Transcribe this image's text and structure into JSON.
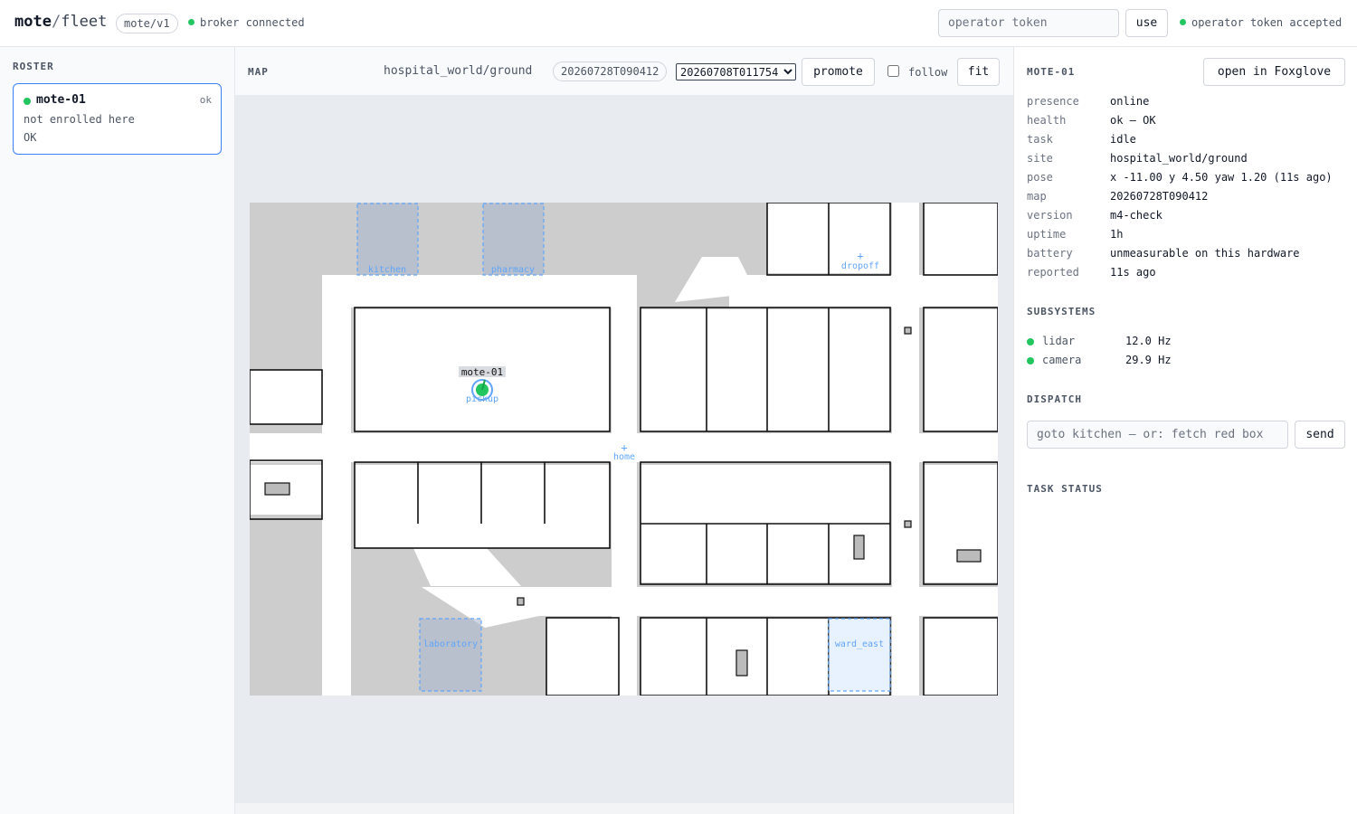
{
  "header": {
    "brand_name": "mote",
    "brand_sep": "/",
    "brand_suffix": "fleet",
    "protocol": "mote/v1",
    "broker_status": "broker connected",
    "token_placeholder": "operator token",
    "use_label": "use",
    "token_status": "operator token accepted"
  },
  "roster": {
    "title": "ROSTER",
    "robots": [
      {
        "name": "mote-01",
        "badge": "ok",
        "note": "not enrolled here",
        "health": "OK"
      }
    ]
  },
  "map": {
    "title": "MAP",
    "site": "hospital_world/ground",
    "current_version": "20260728T090412",
    "selected_version": "20260708T011754",
    "promote_label": "promote",
    "follow_label": "follow",
    "fit_label": "fit",
    "zones": [
      "kitchen",
      "pharmacy",
      "laboratory",
      "ward_east"
    ],
    "points": [
      "dropoff",
      "home",
      "pickup"
    ],
    "robot_label": "mote-01"
  },
  "detail": {
    "title": "MOTE-01",
    "foxglove_label": "open in Foxglove",
    "fields": [
      {
        "key": "presence",
        "value": "online"
      },
      {
        "key": "health",
        "value": "ok — OK"
      },
      {
        "key": "task",
        "value": "idle"
      },
      {
        "key": "site",
        "value": "hospital_world/ground"
      },
      {
        "key": "pose",
        "value": "x -11.00 y 4.50 yaw 1.20 (11s ago)"
      },
      {
        "key": "map",
        "value": "20260728T090412"
      },
      {
        "key": "version",
        "value": "m4-check"
      },
      {
        "key": "uptime",
        "value": "1h"
      },
      {
        "key": "battery",
        "value": "unmeasurable on this hardware"
      },
      {
        "key": "reported",
        "value": "11s ago"
      }
    ],
    "subsystems_title": "SUBSYSTEMS",
    "subsystems": [
      {
        "name": "lidar",
        "rate": "12.0 Hz"
      },
      {
        "name": "camera",
        "rate": "29.9 Hz"
      }
    ],
    "dispatch_title": "DISPATCH",
    "dispatch_placeholder": "goto kitchen — or: fetch red box",
    "send_label": "send",
    "task_status_title": "TASK STATUS"
  },
  "colors": {
    "accent": "#3b82f6",
    "ok": "#22c55e",
    "zone": "#60a5fa"
  }
}
